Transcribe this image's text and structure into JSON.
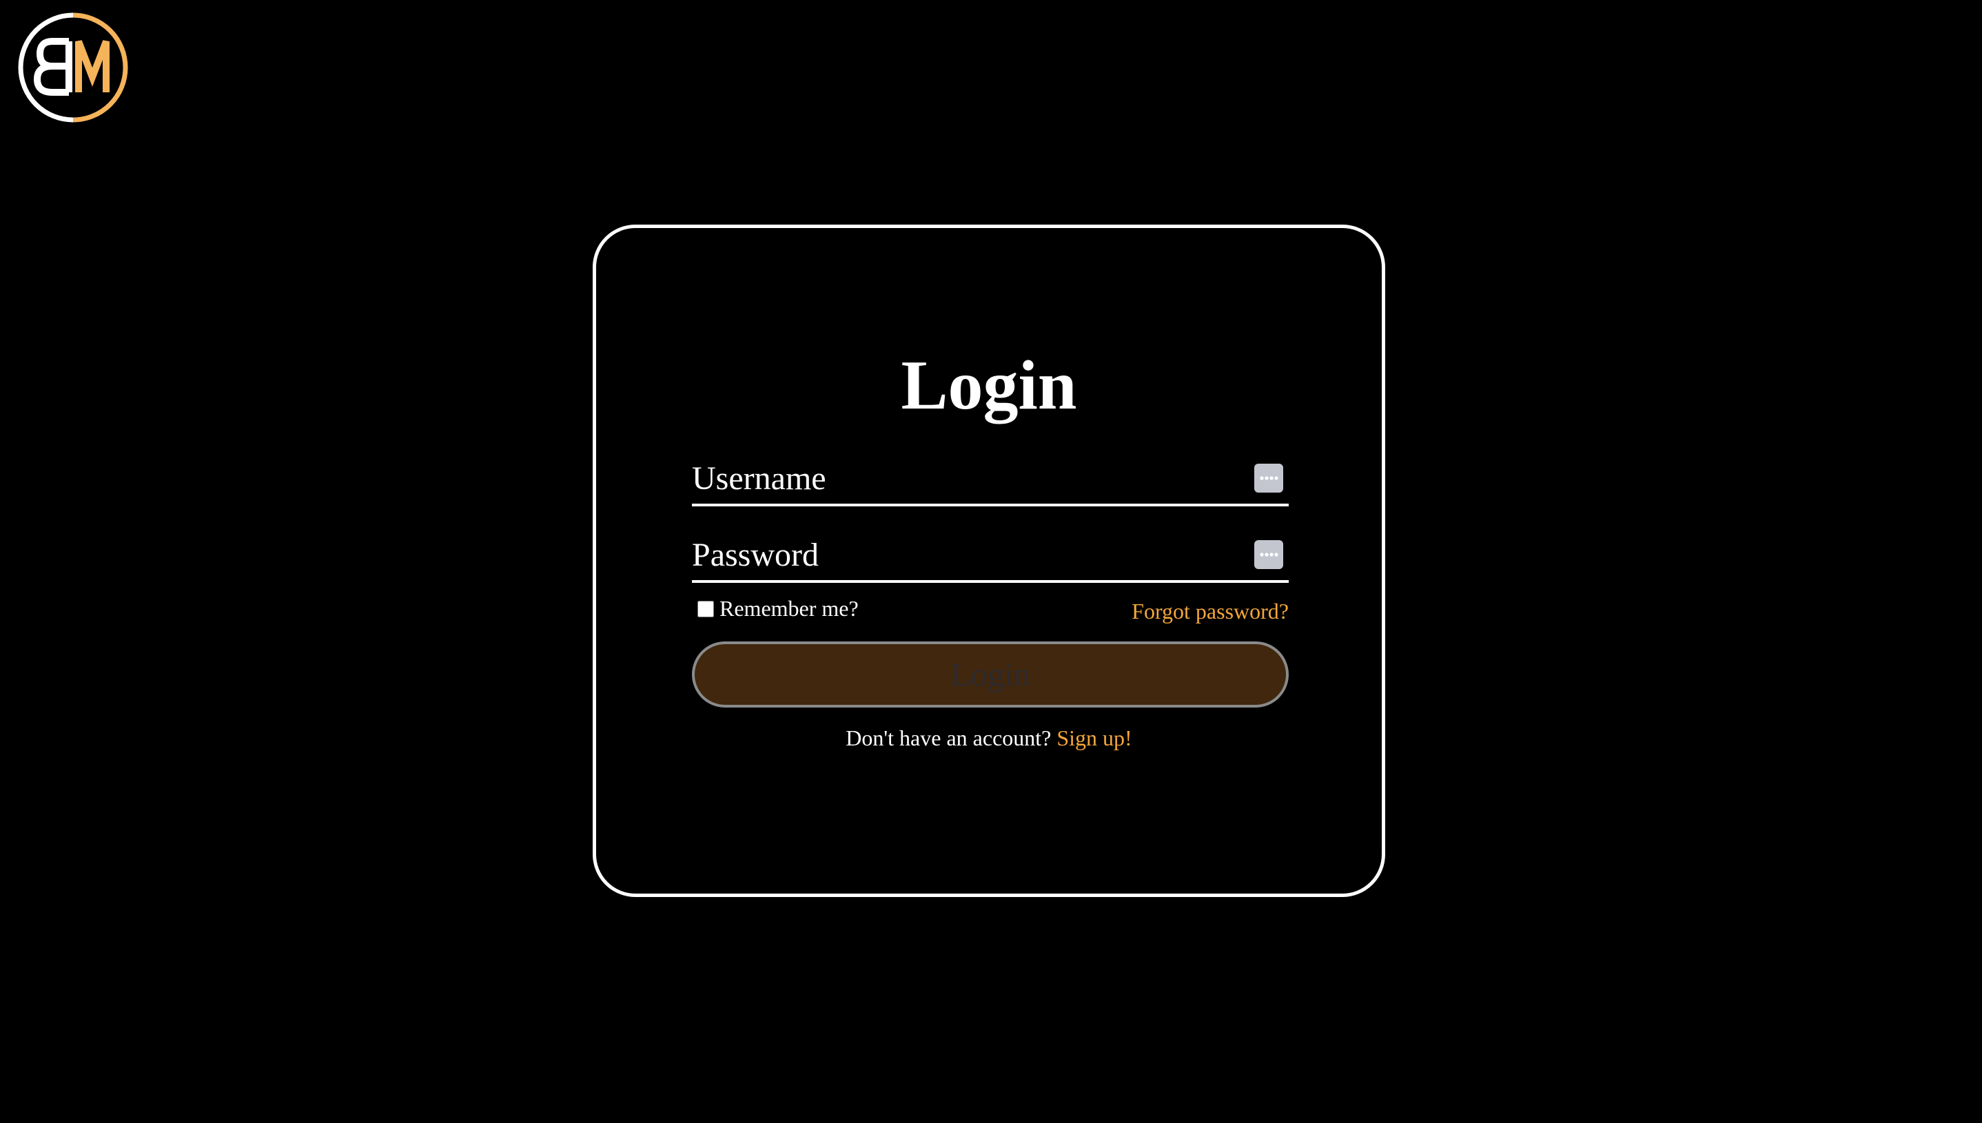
{
  "logo": {
    "letters": "BM",
    "primary_color": "#ffffff",
    "accent_color": "#f5b35a"
  },
  "login": {
    "title": "Login",
    "username_placeholder": "Username",
    "password_placeholder": "Password",
    "remember_label": "Remember me?",
    "forgot_label": "Forgot password?",
    "submit_label": "Login",
    "signup_prompt": "Don't have an account?",
    "signup_link": "Sign up!"
  },
  "colors": {
    "background": "#000000",
    "accent": "#f5a63a",
    "button_bg": "#40270d"
  },
  "icons": {
    "field_icon": "more-dots-icon"
  }
}
